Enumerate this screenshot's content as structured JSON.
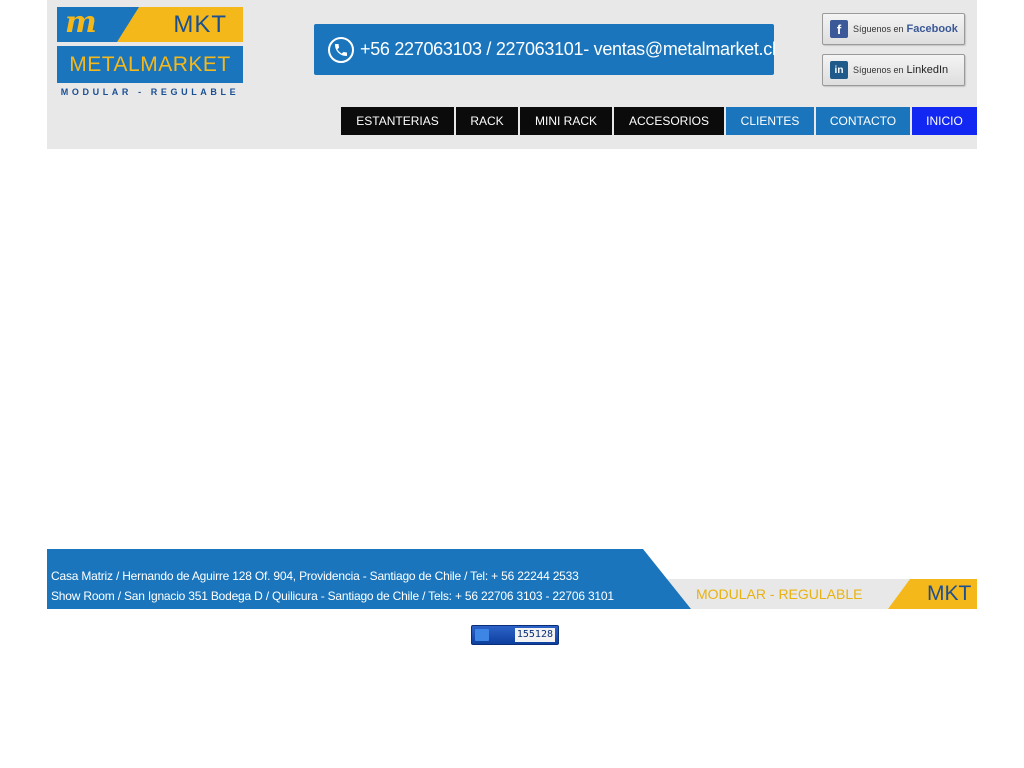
{
  "brand": {
    "logo_mark": "m",
    "logo_short": "MKT",
    "logo_name": "METALMARKET",
    "logo_tagline": "MODULAR - REGULABLE"
  },
  "contact_banner": {
    "text": "+56 227063103 / 227063101- ventas@metalmarket.cl",
    "icon": "phone-icon"
  },
  "social": {
    "facebook": {
      "small": "Síguenos en",
      "big": "Facebook",
      "icon": "facebook-icon"
    },
    "linkedin": {
      "small": "Síguenos en",
      "big": "LinkedIn",
      "icon": "linkedin-icon"
    }
  },
  "nav": [
    {
      "label": "ESTANTERIAS",
      "style": "dark"
    },
    {
      "label": "RACK",
      "style": "dark"
    },
    {
      "label": "MINI RACK",
      "style": "dark"
    },
    {
      "label": "ACCESORIOS",
      "style": "dark"
    },
    {
      "label": "CLIENTES",
      "style": "blue"
    },
    {
      "label": "CONTACTO",
      "style": "blue"
    },
    {
      "label": "INICIO",
      "style": "bright"
    }
  ],
  "footer": {
    "address_line1": "Casa Matriz / Hernando de Aguirre 128 Of. 904, Providencia - Santiago de Chile / Tel: + 56 22244 2533",
    "address_line2": "Show Room / San Ignacio 351 Bodega D / Quilicura - Santiago de Chile / Tels: + 56 22706 3103 - 22706 3101",
    "tagline": "MODULAR - REGULABLE",
    "mark": "MKT"
  },
  "counter": {
    "value": "155128"
  },
  "colors": {
    "header_bg": "#e8e8e8",
    "brand_blue": "#1a75bc",
    "brand_yellow": "#f5b81b",
    "nav_dark": "#0b0b0b",
    "nav_bright": "#1228f2"
  }
}
